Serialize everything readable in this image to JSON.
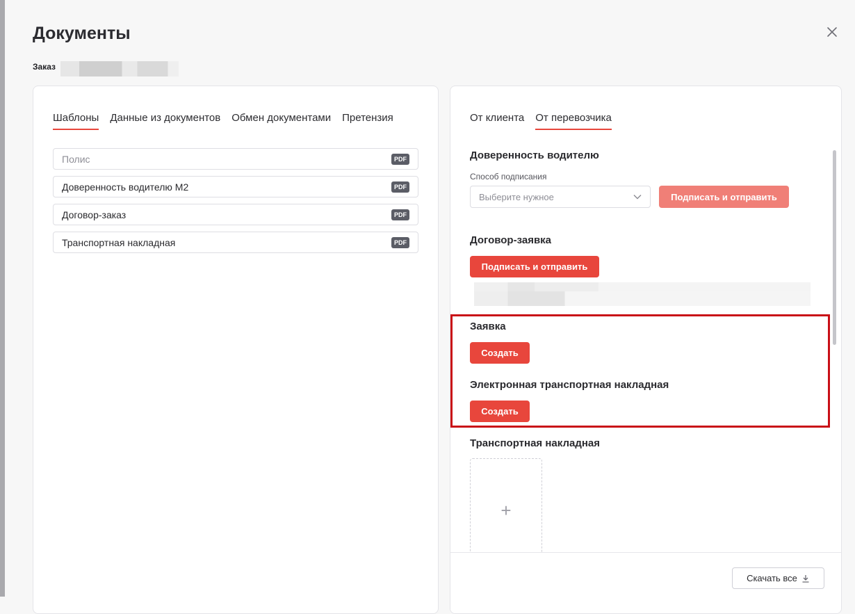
{
  "modal": {
    "title": "Документы",
    "order_label": "Заказ"
  },
  "left_panel": {
    "tabs": [
      {
        "label": "Шаблоны",
        "active": true
      },
      {
        "label": "Данные из документов",
        "active": false
      },
      {
        "label": "Обмен документами",
        "active": false
      },
      {
        "label": "Претензия",
        "active": false
      }
    ],
    "documents": [
      {
        "label": "Полис",
        "badge": "PDF"
      },
      {
        "label": "Доверенность водителю М2",
        "badge": "PDF"
      },
      {
        "label": "Договор-заказ",
        "badge": "PDF"
      },
      {
        "label": "Транспортная накладная",
        "badge": "PDF"
      }
    ]
  },
  "right_panel": {
    "tabs": [
      {
        "label": "От клиента",
        "active": false
      },
      {
        "label": "От перевозчика",
        "active": true
      }
    ],
    "power_of_attorney": {
      "title": "Доверенность водителю",
      "sign_method_label": "Способ подписания",
      "select_placeholder": "Выберите нужное",
      "button": "Подписать и отправить"
    },
    "contract": {
      "title": "Договор-заявка",
      "button": "Подписать и отправить"
    },
    "request": {
      "title": "Заявка",
      "button": "Создать"
    },
    "etn": {
      "title": "Электронная транспортная накладная",
      "button": "Создать"
    },
    "waybill": {
      "title": "Транспортная накладная",
      "upload_symbol": "+"
    },
    "footer": {
      "download_all": "Скачать все"
    }
  },
  "colors": {
    "accent": "#e8463c",
    "accent_disabled": "#f07f77",
    "highlight": "#c90f17"
  },
  "icons": {
    "close": "close-icon",
    "chevron": "chevron-down-icon",
    "download": "download-icon"
  }
}
